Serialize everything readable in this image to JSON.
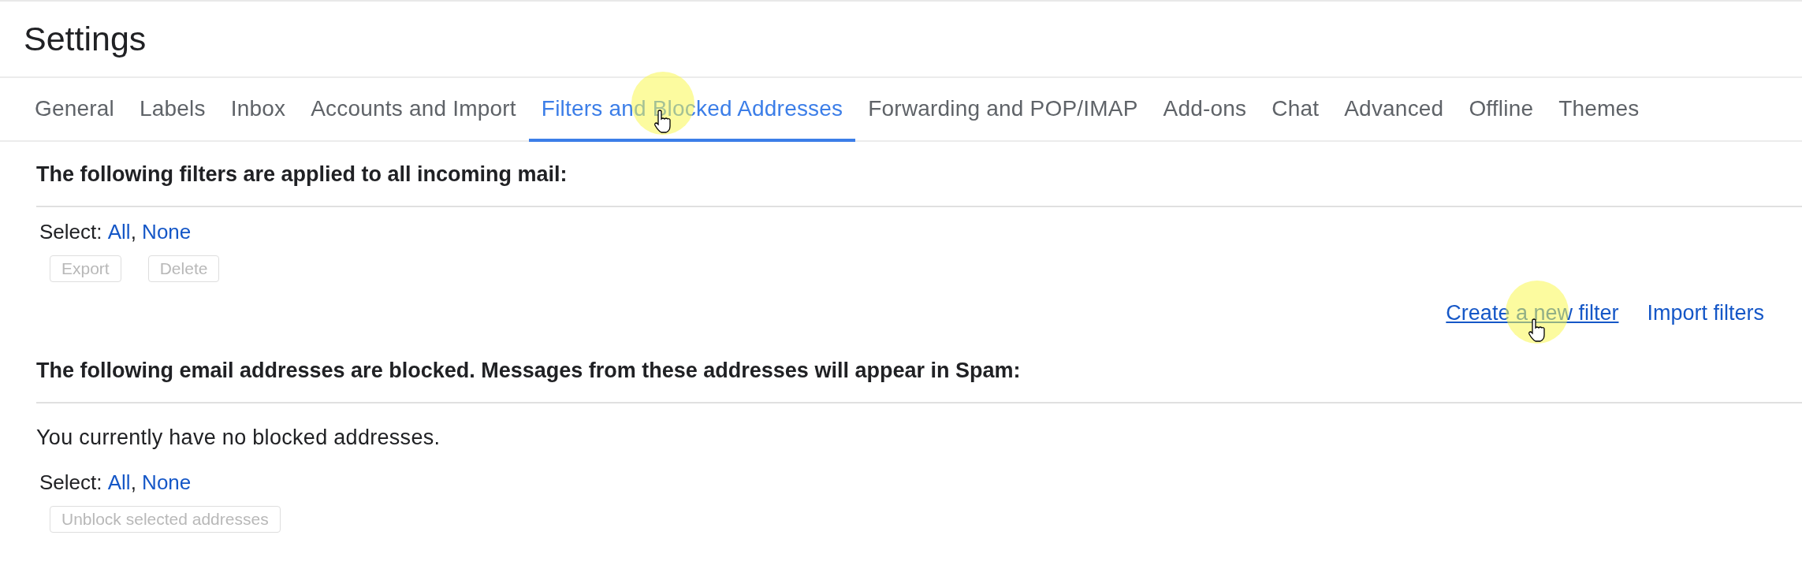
{
  "header": {
    "title": "Settings"
  },
  "tabs": [
    {
      "label": "General",
      "selected": false,
      "pointer": false
    },
    {
      "label": "Labels",
      "selected": false,
      "pointer": false
    },
    {
      "label": "Inbox",
      "selected": false,
      "pointer": false
    },
    {
      "label": "Accounts and Import",
      "selected": false,
      "pointer": false
    },
    {
      "label": "Filters and Blocked Addresses",
      "selected": true,
      "pointer": true
    },
    {
      "label": "Forwarding and POP/IMAP",
      "selected": false,
      "pointer": false
    },
    {
      "label": "Add-ons",
      "selected": false,
      "pointer": false
    },
    {
      "label": "Chat",
      "selected": false,
      "pointer": false
    },
    {
      "label": "Advanced",
      "selected": false,
      "pointer": false
    },
    {
      "label": "Offline",
      "selected": false,
      "pointer": false
    },
    {
      "label": "Themes",
      "selected": false,
      "pointer": false
    }
  ],
  "filters_section": {
    "heading": "The following filters are applied to all incoming mail:",
    "select": {
      "label": "Select:",
      "options": [
        "All",
        "None"
      ],
      "separator": ","
    },
    "buttons": [
      {
        "label": "Export",
        "disabled": true
      },
      {
        "label": "Delete",
        "disabled": true
      }
    ],
    "links": [
      {
        "label": "Create a new filter",
        "underlined": true,
        "pointer": true
      },
      {
        "label": "Import filters",
        "underlined": false,
        "pointer": false
      }
    ]
  },
  "blocked_section": {
    "heading": "The following email addresses are blocked. Messages from these addresses will appear in Spam:",
    "message": "You currently have no blocked addresses.",
    "select": {
      "label": "Select:",
      "options": [
        "All",
        "None"
      ],
      "separator": ","
    },
    "buttons": [
      {
        "label": "Unblock selected addresses",
        "disabled": true
      }
    ]
  }
}
